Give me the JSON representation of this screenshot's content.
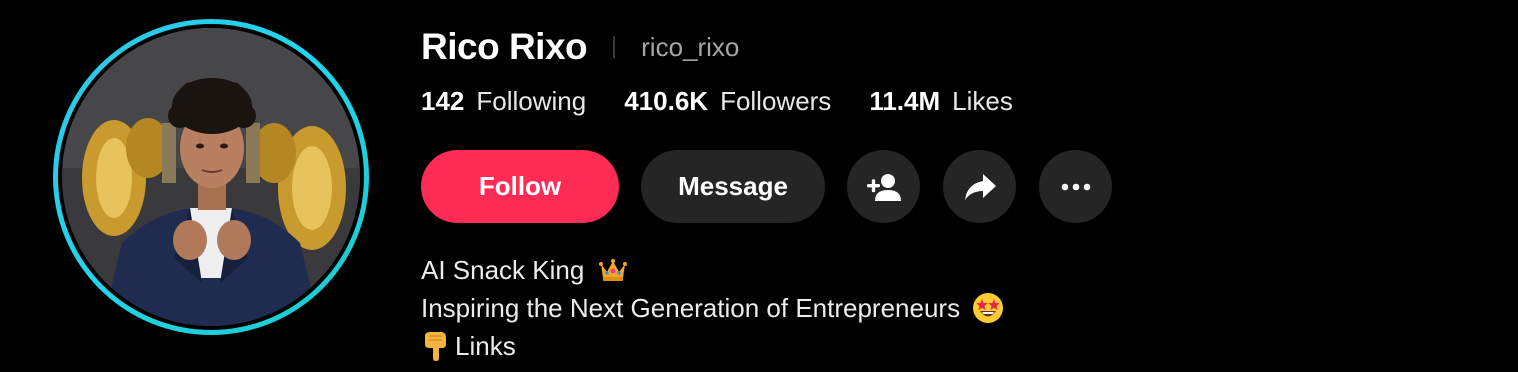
{
  "profile": {
    "display_name": "Rico Rixo",
    "username": "rico_rixo",
    "avatar_alt": "profile-avatar"
  },
  "stats": {
    "following_value": "142",
    "following_label": "Following",
    "followers_value": "410.6K",
    "followers_label": "Followers",
    "likes_value": "11.4M",
    "likes_label": "Likes"
  },
  "actions": {
    "follow_label": "Follow",
    "message_label": "Message",
    "add_friend_icon": "person-add-icon",
    "share_icon": "share-arrow-icon",
    "more_icon": "more-dots-icon"
  },
  "bio": {
    "line1_text": "AI Snack King",
    "line1_emoji": "crown-icon",
    "line2_text": "Inspiring the Next Generation of Entrepreneurs",
    "line2_emoji": "star-struck-icon",
    "line3_emoji": "pointing-down-icon",
    "line3_text": "Links"
  },
  "colors": {
    "background": "#000000",
    "follow_button": "#fe2c55",
    "secondary_button": "#252525",
    "avatar_ring": "#20d5ec",
    "username_text": "#a6a6a6"
  }
}
